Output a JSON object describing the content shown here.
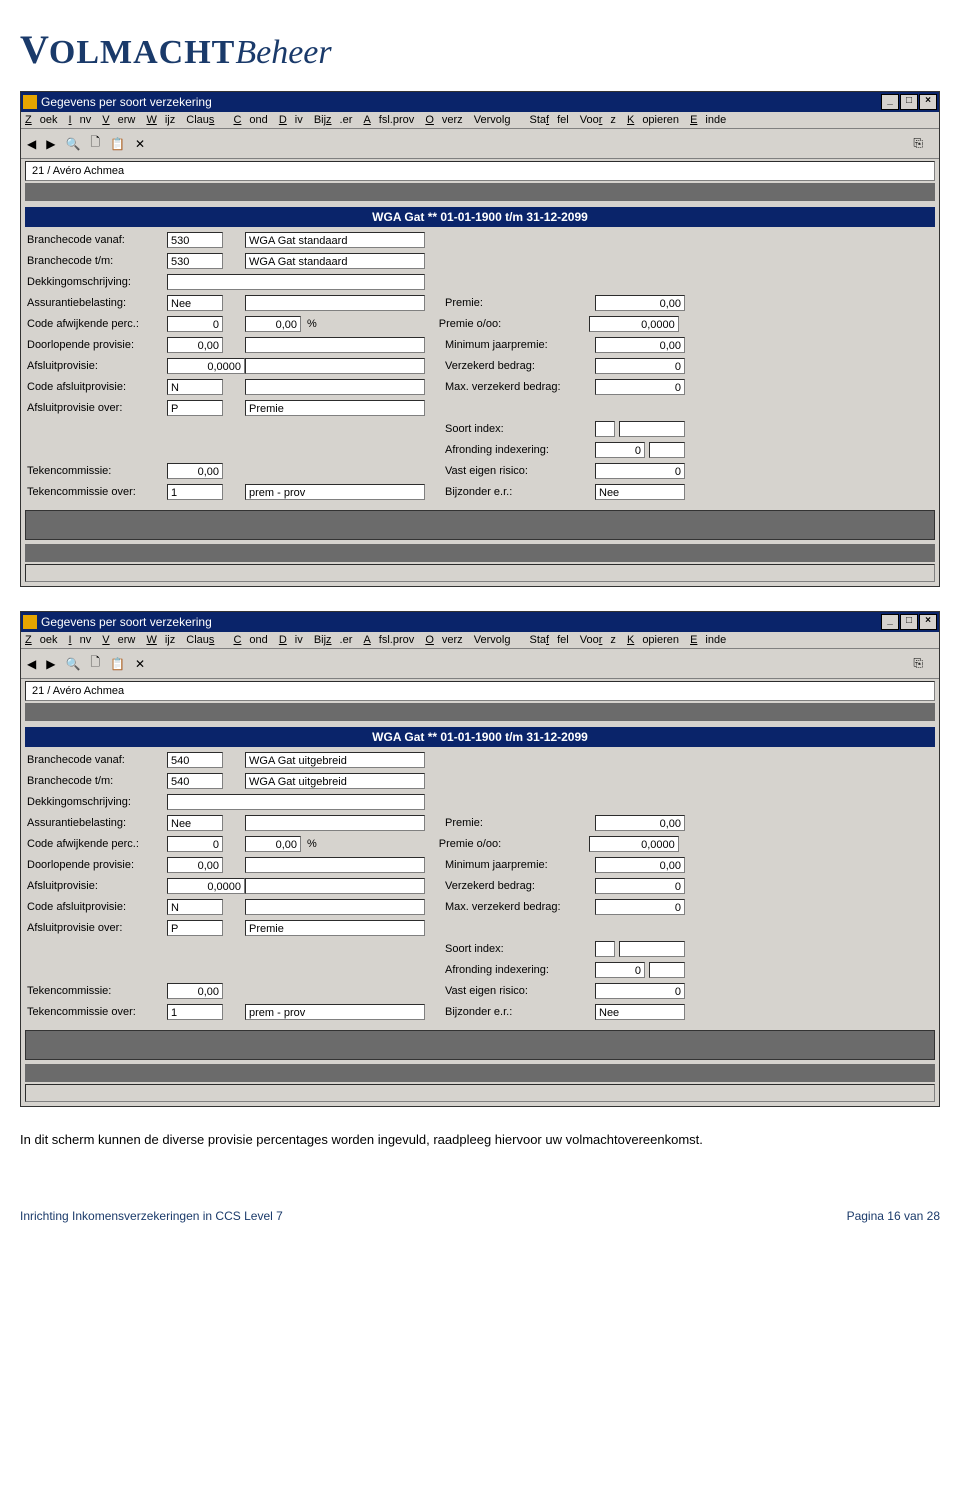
{
  "logo": {
    "volmacht": "OLMACHT",
    "beheer": "Beheer"
  },
  "menu": [
    "Zoek",
    "Inv",
    "Verw",
    "Wijz",
    "Claus",
    "Cond",
    "Div",
    "Bijz.er",
    "Afsl.prov",
    "Overz",
    "Vervolg",
    "Staffel",
    "Voorz",
    "Kopieren",
    "Einde"
  ],
  "toolbar_icons": [
    "◀",
    "▶",
    "🔍",
    "🗋",
    "📋",
    "✕",
    "⎘"
  ],
  "labels": {
    "branchecode_vanaf": "Branchecode vanaf:",
    "branchecode_tm": "Branchecode t/m:",
    "dekkingomschrijving": "Dekkingomschrijving:",
    "assurantiebelasting": "Assurantiebelasting:",
    "code_afwijkende_perc": "Code afwijkende perc.:",
    "doorlopende_provisie": "Doorlopende provisie:",
    "afsluitprovisie": "Afsluitprovisie:",
    "code_afsluitprovisie": "Code afsluitprovisie:",
    "afsluitprovisie_over": "Afsluitprovisie over:",
    "tekencommissie": "Tekencommissie:",
    "tekencommissie_over": "Tekencommissie over:",
    "premie": "Premie:",
    "premie_ooo": "Premie o/oo:",
    "minimum_jaarpremie": "Minimum jaarpremie:",
    "verzekerd_bedrag": "Verzekerd bedrag:",
    "max_verzekerd_bedrag": "Max. verzekerd bedrag:",
    "soort_index": "Soort index:",
    "afronding_indexering": "Afronding indexering:",
    "vast_eigen_risico": "Vast eigen risico:",
    "bijzonder_er": "Bijzonder e.r.:",
    "percent": "%"
  },
  "windows": [
    {
      "title": "Gegevens per soort verzekering",
      "crumb": "21 / Avéro Achmea",
      "section": "WGA Gat ** 01-01-1900 t/m 31-12-2099",
      "fields": {
        "branchecode_vanaf": "530",
        "branche_vanaf_naam": "WGA Gat standaard",
        "branchecode_tm": "530",
        "branche_tm_naam": "WGA Gat standaard",
        "dekkingomschrijving": "",
        "assurantiebelasting": "Nee",
        "assurantiebelasting_extra": "",
        "code_afwijkende_perc": "0",
        "code_afw_pct": "0,00",
        "doorlopende_provisie": "0,00",
        "doorlopende_provisie_extra": "",
        "afsluitprovisie": "0,0000",
        "afsluitprovisie_extra": "",
        "code_afsluitprovisie": "N",
        "code_afsluitprov_extra": "",
        "afsluitprovisie_over": "P",
        "afsluitprovisie_over_naam": "Premie",
        "tekencommissie": "0,00",
        "tekencommissie_over": "1",
        "tekencommissie_over_naam": "prem - prov",
        "premie": "0,00",
        "premie_ooo": "0,0000",
        "minimum_jaarpremie": "0,00",
        "verzekerd_bedrag": "0",
        "max_verzekerd_bedrag": "0",
        "soort_index_a": "",
        "soort_index_b": "",
        "afronding_indexering": "0",
        "afronding_indexering_b": "",
        "vast_eigen_risico": "0",
        "bijzonder_er": "Nee"
      }
    },
    {
      "title": "Gegevens per soort verzekering",
      "crumb": "21 / Avéro Achmea",
      "section": "WGA Gat ** 01-01-1900 t/m 31-12-2099",
      "fields": {
        "branchecode_vanaf": "540",
        "branche_vanaf_naam": "WGA Gat uitgebreid",
        "branchecode_tm": "540",
        "branche_tm_naam": "WGA Gat uitgebreid",
        "dekkingomschrijving": "",
        "assurantiebelasting": "Nee",
        "assurantiebelasting_extra": "",
        "code_afwijkende_perc": "0",
        "code_afw_pct": "0,00",
        "doorlopende_provisie": "0,00",
        "doorlopende_provisie_extra": "",
        "afsluitprovisie": "0,0000",
        "afsluitprovisie_extra": "",
        "code_afsluitprovisie": "N",
        "code_afsluitprov_extra": "",
        "afsluitprovisie_over": "P",
        "afsluitprovisie_over_naam": "Premie",
        "tekencommissie": "0,00",
        "tekencommissie_over": "1",
        "tekencommissie_over_naam": "prem - prov",
        "premie": "0,00",
        "premie_ooo": "0,0000",
        "minimum_jaarpremie": "0,00",
        "verzekerd_bedrag": "0",
        "max_verzekerd_bedrag": "0",
        "soort_index_a": "",
        "soort_index_b": "",
        "afronding_indexering": "0",
        "afronding_indexering_b": "",
        "vast_eigen_risico": "0",
        "bijzonder_er": "Nee"
      }
    }
  ],
  "caption": "In dit scherm kunnen de diverse provisie percentages worden ingevuld, raadpleeg hiervoor uw volmachtovereenkomst.",
  "footer": {
    "left": "Inrichting Inkomensverzekeringen in CCS Level 7",
    "right": "Pagina 16 van 28"
  }
}
